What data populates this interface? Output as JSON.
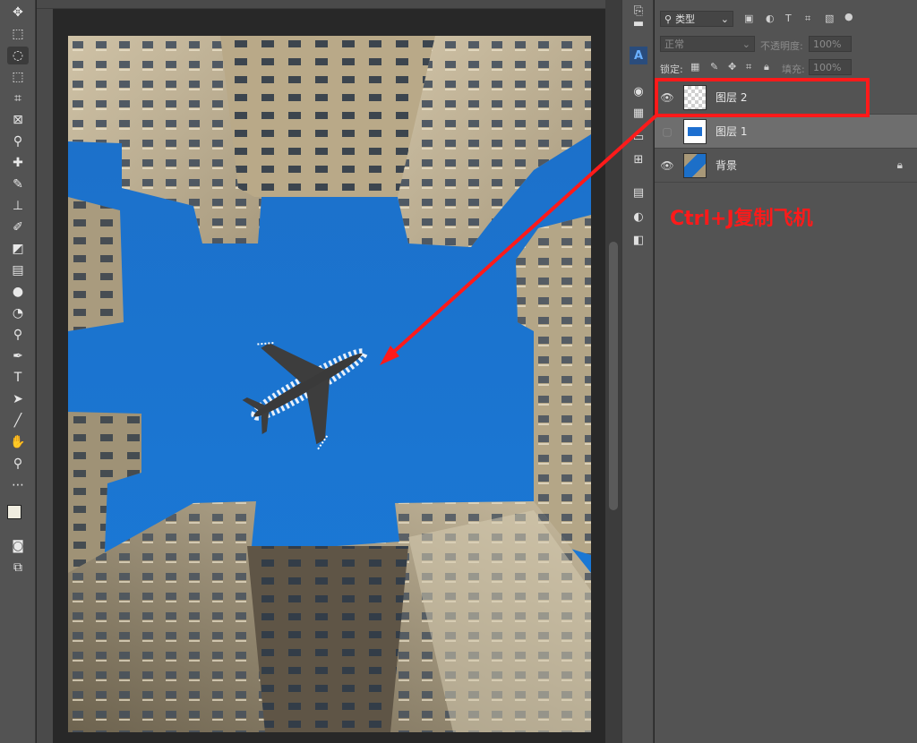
{
  "toolbar": {
    "tools": [
      {
        "icon": "move-icon",
        "glyph": "✥"
      },
      {
        "icon": "marquee-icon",
        "glyph": "⬚"
      },
      {
        "icon": "lasso-icon",
        "glyph": "◌"
      },
      {
        "icon": "object-select-icon",
        "glyph": "⬚"
      },
      {
        "icon": "crop-icon",
        "glyph": "⌗"
      },
      {
        "icon": "frame-icon",
        "glyph": "⊠"
      },
      {
        "icon": "eyedropper-icon",
        "glyph": "⚲"
      },
      {
        "icon": "healing-icon",
        "glyph": "✚"
      },
      {
        "icon": "brush-icon",
        "glyph": "✎"
      },
      {
        "icon": "stamp-icon",
        "glyph": "⊥"
      },
      {
        "icon": "history-brush-icon",
        "glyph": "✐"
      },
      {
        "icon": "eraser-icon",
        "glyph": "◩"
      },
      {
        "icon": "gradient-icon",
        "glyph": "▤"
      },
      {
        "icon": "blur-icon",
        "glyph": "●"
      },
      {
        "icon": "dodge-icon",
        "glyph": "◔"
      },
      {
        "icon": "dodge-tool-icon",
        "glyph": "⚲"
      },
      {
        "icon": "pen-icon",
        "glyph": "✒"
      },
      {
        "icon": "type-icon",
        "glyph": "T"
      },
      {
        "icon": "path-select-icon",
        "glyph": "➤"
      },
      {
        "icon": "line-icon",
        "glyph": "╱"
      },
      {
        "icon": "hand-icon",
        "glyph": "✋"
      },
      {
        "icon": "zoom-icon",
        "glyph": "⚲"
      },
      {
        "icon": "more-tools-icon",
        "glyph": "⋯"
      }
    ],
    "foreground_color": "#f0ede0",
    "background_color": "#ffffff"
  },
  "layers_panel": {
    "filter_label": "类型",
    "blend_mode": "正常",
    "opacity_label": "不透明度:",
    "opacity_value": "100%",
    "lock_label": "锁定:",
    "fill_label": "填充:",
    "fill_value": "100%",
    "layers": [
      {
        "name": "图层 2",
        "visible": true,
        "selected": false,
        "highlighted": true
      },
      {
        "name": "图层 1",
        "visible": false,
        "selected": true
      },
      {
        "name": "背景",
        "visible": true,
        "locked": true
      }
    ]
  },
  "annotation": {
    "text": "Ctrl+J复制飞机",
    "color": "#ff1a1a"
  }
}
